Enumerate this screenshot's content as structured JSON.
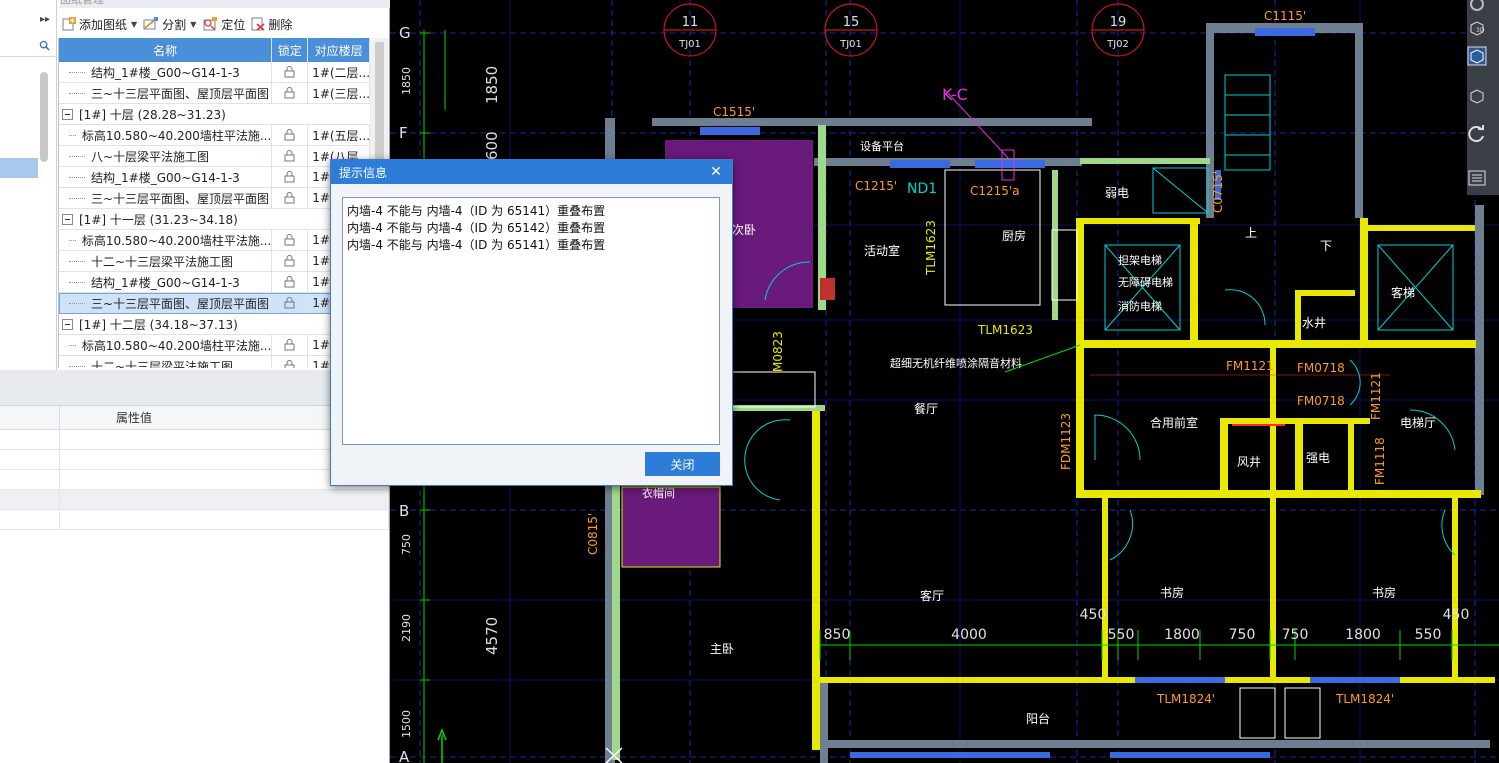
{
  "panel": {
    "title": "图纸管理",
    "toolbar": {
      "add_label": "添加图纸",
      "split_label": "分割",
      "locate_label": "定位",
      "delete_label": "删除"
    },
    "table": {
      "headers": {
        "name": "名称",
        "lock": "锁定",
        "floor": "对应楼层"
      },
      "rows": [
        {
          "type": "child",
          "name": "结构_1#楼_G00~G14-1-3",
          "floor": "1#(二层..."
        },
        {
          "type": "child",
          "name": "三~十三层平面图、屋顶层平面图",
          "floor": "1#(三层..."
        },
        {
          "type": "group",
          "name": "[1#] 十层 (28.28~31.23)"
        },
        {
          "type": "child",
          "name": "标高10.580~40.200墙柱平法施...",
          "floor": "1#(五层..."
        },
        {
          "type": "child",
          "name": "八~十层梁平法施工图",
          "floor": "1#(八层"
        },
        {
          "type": "child",
          "name": "结构_1#楼_G00~G14-1-3",
          "floor": "1#("
        },
        {
          "type": "child",
          "name": "三~十三层平面图、屋顶层平面图",
          "floor": "1#("
        },
        {
          "type": "group",
          "name": "[1#] 十一层 (31.23~34.18)"
        },
        {
          "type": "child",
          "name": "标高10.580~40.200墙柱平法施...",
          "floor": "1#("
        },
        {
          "type": "child",
          "name": "十二~十三层梁平法施工图",
          "floor": "1#("
        },
        {
          "type": "child",
          "name": "结构_1#楼_G00~G14-1-3",
          "floor": "1#("
        },
        {
          "type": "child",
          "name": "三~十三层平面图、屋顶层平面图",
          "floor": "1#(",
          "selected": true
        },
        {
          "type": "group",
          "name": "[1#] 十二层 (34.18~37.13)"
        },
        {
          "type": "child",
          "name": "标高10.580~40.200墙柱平法施...",
          "floor": "1#("
        },
        {
          "type": "child",
          "name": "十二~十三层梁平法施工图",
          "floor": "1#("
        }
      ]
    },
    "properties": {
      "value_header": "属性值"
    }
  },
  "dialog": {
    "title": "提示信息",
    "close_icon": "close-icon",
    "messages": [
      "内墙-4 不能与 内墙-4（ID 为 65141）重叠布置",
      "内墙-4 不能与 内墙-4（ID 为 65142）重叠布置",
      "内墙-4 不能与 内墙-4（ID 为 65141）重叠布置"
    ],
    "close_button": "关闭"
  },
  "cad": {
    "axis_bubbles": [
      "11",
      "15",
      "19"
    ],
    "axis_tags": [
      "TJ01",
      "TJ01",
      "TJ02"
    ],
    "row_axes": [
      "G",
      "F",
      "B",
      "A"
    ],
    "dims_vertical": [
      "1850",
      "1850",
      "600",
      "4570",
      "750",
      "2190",
      "1500"
    ],
    "dims_horizontal": [
      "850",
      "4000",
      "450",
      "550",
      "1800",
      "750",
      "750",
      "1800",
      "550",
      "450"
    ],
    "labels": [
      "C1515'",
      "C1115'",
      "K-C",
      "设备平台",
      "C1215'",
      "ND1",
      "C1215'a",
      "弱电",
      "C0715'",
      "活动室",
      "TLM1623",
      "厨房",
      "担架电梯",
      "无障碍电梯",
      "消防电梯",
      "上",
      "下",
      "客梯",
      "水井",
      "TLM1623",
      "超细无机纤维喷涂隔音材料",
      "M0823",
      "FM1121",
      "FM0718",
      "FM0718",
      "FM1121",
      "餐厅",
      "合用前室",
      "FDM1123",
      "风井",
      "强电",
      "FM1118",
      "电梯厅",
      "衣帽间",
      "C0815'",
      "客厅",
      "书房",
      "书房",
      "主卧",
      "TLM1824'",
      "TLM1824'",
      "阳台",
      "次卧"
    ],
    "colors": {
      "wall_yellow": "#e8e800",
      "wall_gray": "#6d7f90",
      "dim_green": "#00d800",
      "grid_blue": "#2040c8",
      "purple_fill": "#6a1a7a",
      "red": "#ff2a2a",
      "cyan": "#00d0d0",
      "orange": "#ff9a1a",
      "magenta": "#e030e0"
    }
  }
}
